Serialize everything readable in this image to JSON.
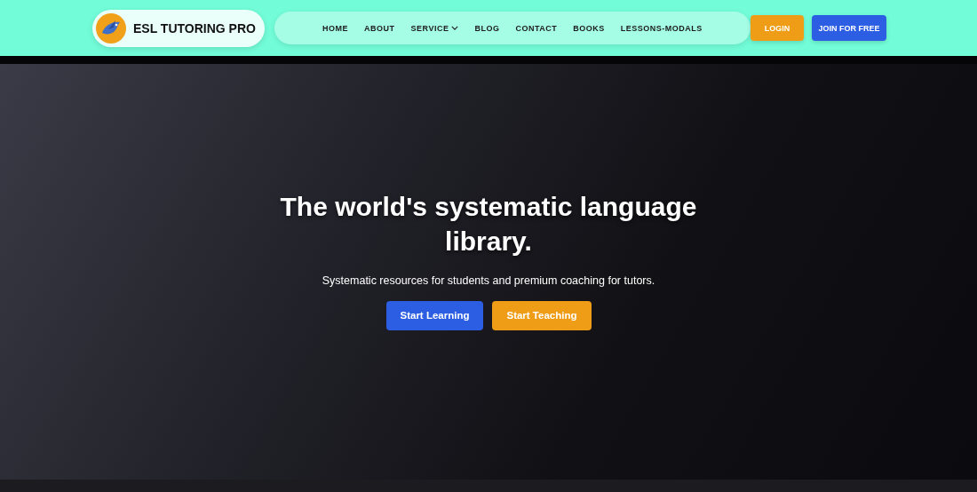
{
  "brand": {
    "name": "ESL TUTORING PRO"
  },
  "nav": [
    {
      "label": "HOME",
      "has_menu": false
    },
    {
      "label": "ABOUT",
      "has_menu": false
    },
    {
      "label": "SERVICE",
      "has_menu": true
    },
    {
      "label": "BLOG",
      "has_menu": false
    },
    {
      "label": "CONTACT",
      "has_menu": false
    },
    {
      "label": "BOOKS",
      "has_menu": false
    },
    {
      "label": "LESSONS-MODALS",
      "has_menu": false
    }
  ],
  "auth": [
    {
      "label": "LOGIN",
      "kind": "login"
    },
    {
      "label": "JOIN FOR FREE",
      "kind": "join"
    }
  ],
  "hero": {
    "title": "The world's systematic language library.",
    "subtitle": "Systematic resources for students and premium coaching for tutors.",
    "buttons": [
      {
        "label": "Start Learning",
        "kind": "primary"
      },
      {
        "label": "Start Teaching",
        "kind": "secondary"
      }
    ]
  }
}
